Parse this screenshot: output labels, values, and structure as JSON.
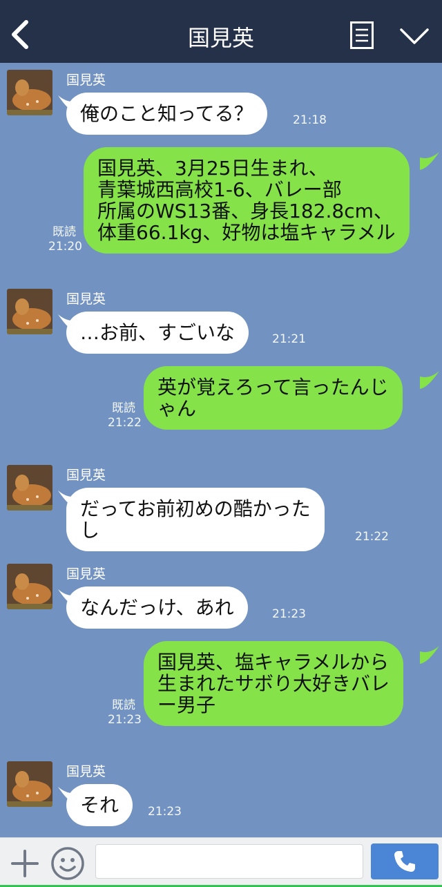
{
  "header": {
    "title": "国見英"
  },
  "messages": [
    {
      "side": "in",
      "sender": "国見英",
      "text": "俺のこと知ってる？",
      "time": "21:18"
    },
    {
      "side": "out",
      "text": "国見英、3月25日生まれ、\n青葉城西高校1-6、バレー部\n所属のWS13番、身長182.8cm、\n体重66.1kg、好物は塩キャラメル",
      "read": "既読",
      "time": "21:20"
    },
    {
      "side": "in",
      "sender": "国見英",
      "text": "…お前、すごいな",
      "time": "21:21"
    },
    {
      "side": "out",
      "text": "英が覚えろって言ったんじ\nゃん",
      "read": "既読",
      "time": "21:22"
    },
    {
      "side": "in",
      "sender": "国見英",
      "text": "だってお前初めの酷かった\nし",
      "time": "21:22"
    },
    {
      "side": "in",
      "sender": "国見英",
      "text": "なんだっけ、あれ",
      "time": "21:23"
    },
    {
      "side": "out",
      "text": "国見英、塩キャラメルから\n生まれたサボり大好きバレ\nー男子",
      "read": "既読",
      "time": "21:23"
    },
    {
      "side": "in",
      "sender": "国見英",
      "text": "それ",
      "time": "21:23"
    }
  ],
  "input": {
    "placeholder": ""
  },
  "colors": {
    "background": "#7293c2",
    "header": "#253149",
    "outgoing": "#85e249",
    "incoming": "#ffffff",
    "send_button": "#4b86d6"
  },
  "icons": [
    "back-chevron-icon",
    "menu-icon",
    "chevron-down-icon",
    "plus-icon",
    "smiley-icon",
    "phone-icon"
  ]
}
